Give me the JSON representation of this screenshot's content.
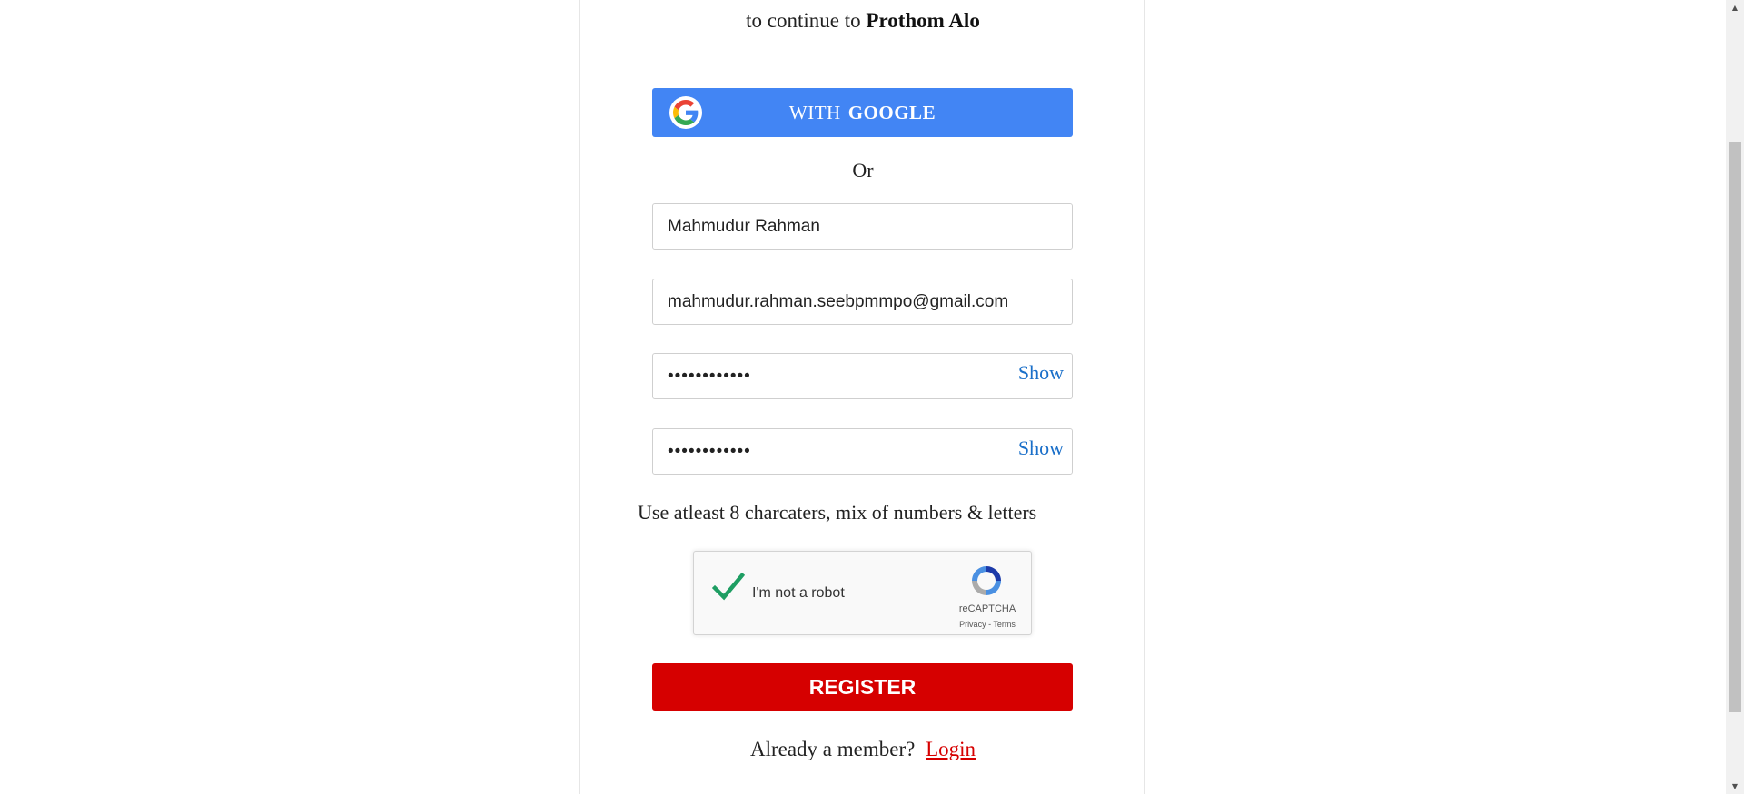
{
  "header": {
    "subtitle_prefix": "to continue to",
    "brand": "Prothom Alo"
  },
  "google_button": {
    "label_prefix": "WITH",
    "label_brand": "GOOGLE",
    "icon": "google-g-icon"
  },
  "separator": "Or",
  "form": {
    "name_value": "Mahmudur Rahman",
    "email_value": "mahmudur.rahman.seebpmmpo@gmail.com",
    "password_value": "••••••••••••",
    "confirm_value": "••••••••••••",
    "show_label": "Show",
    "hint": "Use atleast 8 charcaters, mix of numbers & letters"
  },
  "recaptcha": {
    "label": "I'm not a robot",
    "checked": true,
    "brand": "reCAPTCHA",
    "privacy": "Privacy",
    "separator": " - ",
    "terms": "Terms"
  },
  "register_button": "REGISTER",
  "footer": {
    "member_text": "Already a member?",
    "login_link": "Login"
  },
  "colors": {
    "google_blue": "#4285f4",
    "register_red": "#d60000",
    "link_blue": "#1a6fc9",
    "check_green": "#1e9e63"
  }
}
